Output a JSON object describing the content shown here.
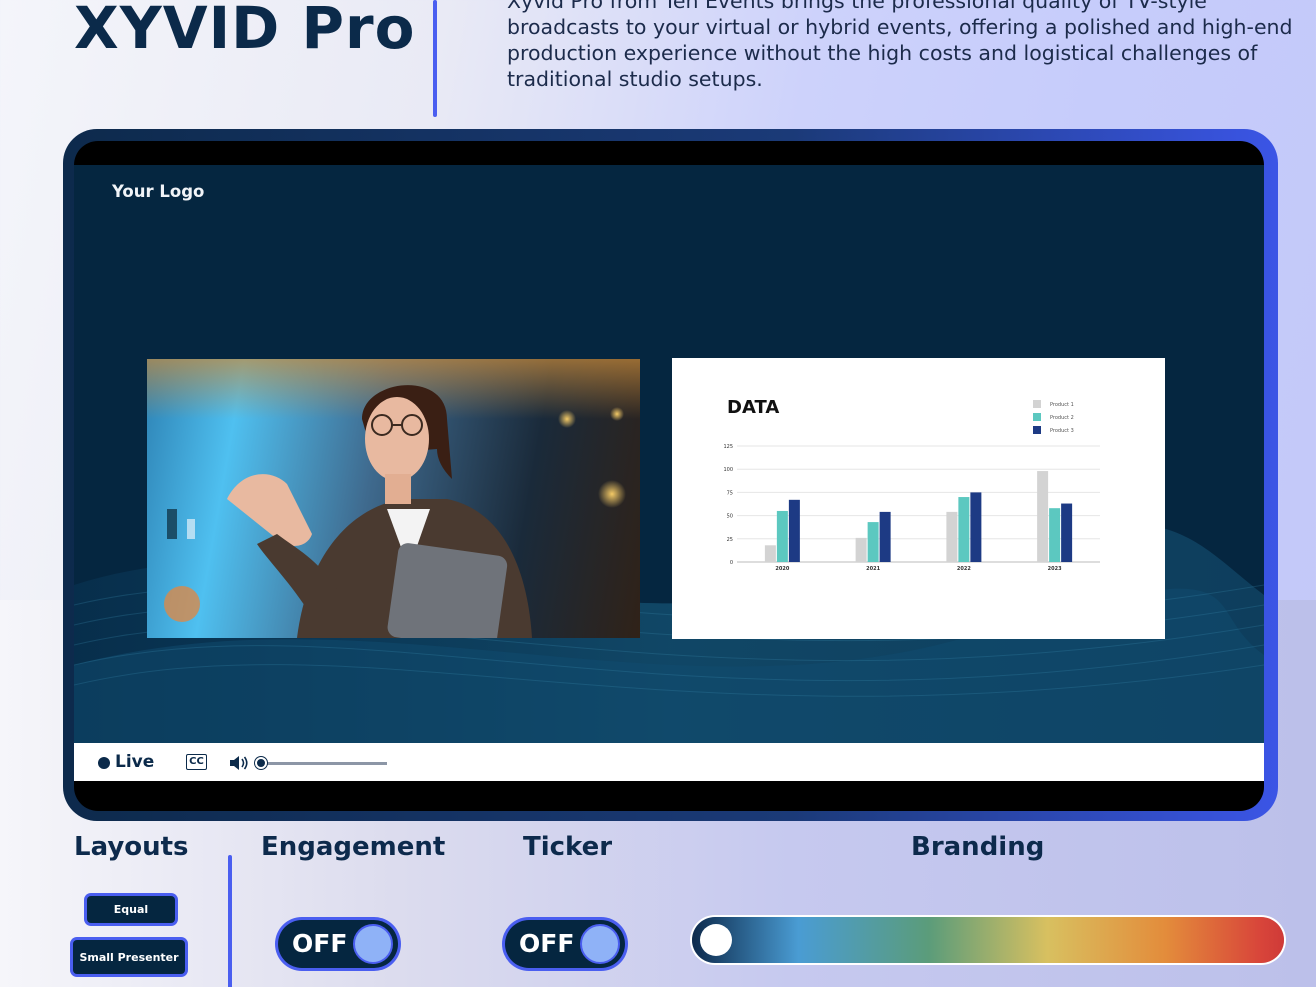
{
  "header": {
    "title": "XYVID Pro",
    "intro": "Xyvid Pro from Ten Events brings the professional quality of TV-style broadcasts to your virtual or hybrid events, offering a polished and high-end production experience without the high costs and logistical challenges of traditional studio setups."
  },
  "player": {
    "logo_text": "Your Logo",
    "live_label": "Live",
    "cc_label": "CC",
    "volume_level": 0.0
  },
  "slide": {
    "title": "DATA"
  },
  "chart_data": {
    "type": "bar",
    "title": "DATA",
    "categories": [
      "2020",
      "2021",
      "2022",
      "2023"
    ],
    "series": [
      {
        "name": "Product 1",
        "color": "#d3d3d3",
        "values": [
          18,
          26,
          54,
          98
        ]
      },
      {
        "name": "Product 2",
        "color": "#5cc8c0",
        "values": [
          55,
          43,
          70,
          58
        ]
      },
      {
        "name": "Product 3",
        "color": "#1d3a84",
        "values": [
          67,
          54,
          75,
          63
        ]
      }
    ],
    "yticks": [
      "0",
      "25",
      "50",
      "75",
      "100",
      "125"
    ],
    "ylim": [
      0,
      125
    ],
    "grid": true,
    "legend": "top-right"
  },
  "sections": {
    "layouts": "Layouts",
    "engagement": "Engagement",
    "ticker": "Ticker",
    "branding": "Branding"
  },
  "layout_buttons": {
    "equal": "Equal",
    "small_presenter": "Small Presenter"
  },
  "toggles": {
    "engagement": "OFF",
    "ticker": "OFF"
  },
  "colors": {
    "navy": "#052640",
    "accent": "#4a5ef0"
  }
}
